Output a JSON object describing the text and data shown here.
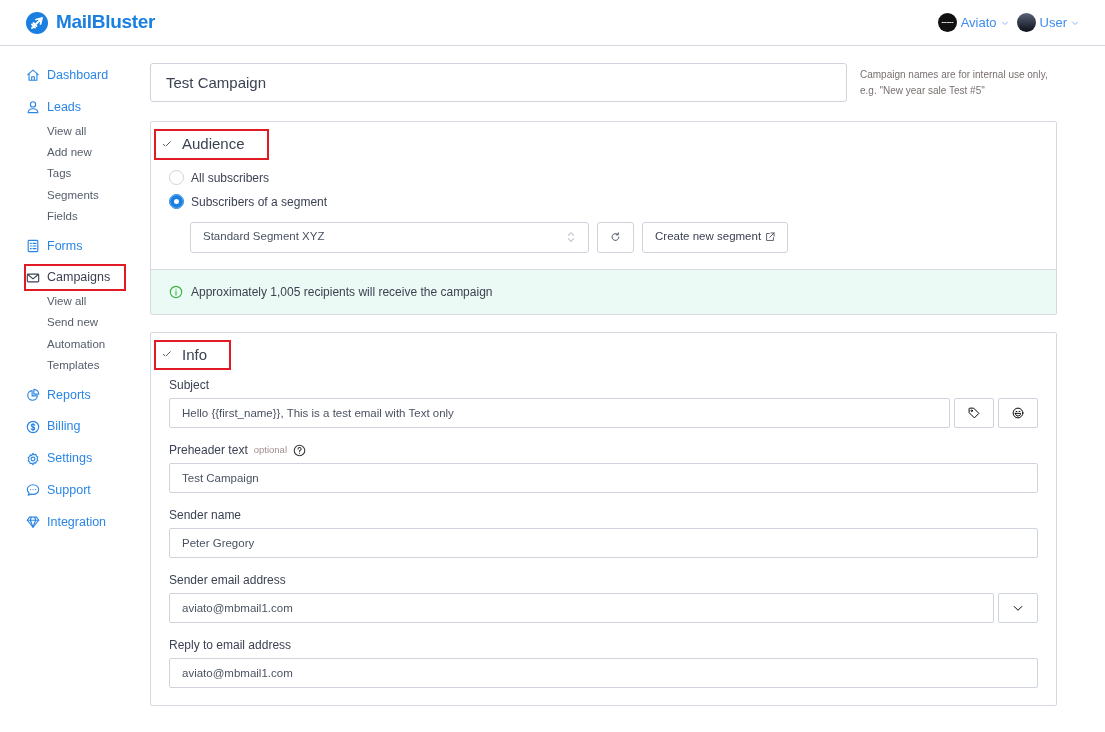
{
  "header": {
    "brand": "MailBluster",
    "menus": [
      {
        "label": "Aviato",
        "kind": "workspace"
      },
      {
        "label": "User",
        "kind": "user"
      }
    ]
  },
  "sidebar": {
    "items": [
      {
        "label": "Dashboard",
        "highlighted": false
      },
      {
        "label": "Leads",
        "highlighted": false,
        "children": [
          {
            "label": "View all"
          },
          {
            "label": "Add new"
          },
          {
            "label": "Tags"
          },
          {
            "label": "Segments"
          },
          {
            "label": "Fields"
          }
        ]
      },
      {
        "label": "Forms",
        "highlighted": false
      },
      {
        "label": "Campaigns",
        "highlighted": true,
        "children": [
          {
            "label": "View all"
          },
          {
            "label": "Send new"
          },
          {
            "label": "Automation"
          },
          {
            "label": "Templates"
          }
        ]
      },
      {
        "label": "Reports",
        "highlighted": false
      },
      {
        "label": "Billing",
        "highlighted": false
      },
      {
        "label": "Settings",
        "highlighted": false
      },
      {
        "label": "Support",
        "highlighted": false
      },
      {
        "label": "Integration",
        "highlighted": false
      }
    ]
  },
  "campaign_name": {
    "value": "Test Campaign",
    "hint_lines": [
      "Campaign names are for internal use only,",
      "e.g. \"New year sale Test #5\""
    ]
  },
  "sections": [
    {
      "kind": "audience",
      "title": "Audience",
      "highlighted": true,
      "options": [
        {
          "label": "All subscribers",
          "selected": false
        },
        {
          "label": "Subscribers of a segment",
          "selected": true
        }
      ],
      "segment_select": {
        "value": "Standard Segment XYZ"
      },
      "create_button": "Create new segment",
      "notice": "Approximately 1,005 recipients will receive the campaign"
    },
    {
      "kind": "info",
      "title": "Info",
      "highlighted": true,
      "fields": [
        {
          "kind": "subject",
          "label": "Subject",
          "value": "Hello {{first_name}}, This is a test email with Text only"
        },
        {
          "kind": "preheader",
          "label": "Preheader text",
          "optional": "optional",
          "value": "Test Campaign"
        },
        {
          "kind": "plain",
          "label": "Sender name",
          "value": "Peter Gregory"
        },
        {
          "kind": "dropdown",
          "label": "Sender email address",
          "value": "aviato@mbmail1.com"
        },
        {
          "kind": "plain",
          "label": "Reply to email address",
          "value": "aviato@mbmail1.com"
        }
      ]
    }
  ]
}
